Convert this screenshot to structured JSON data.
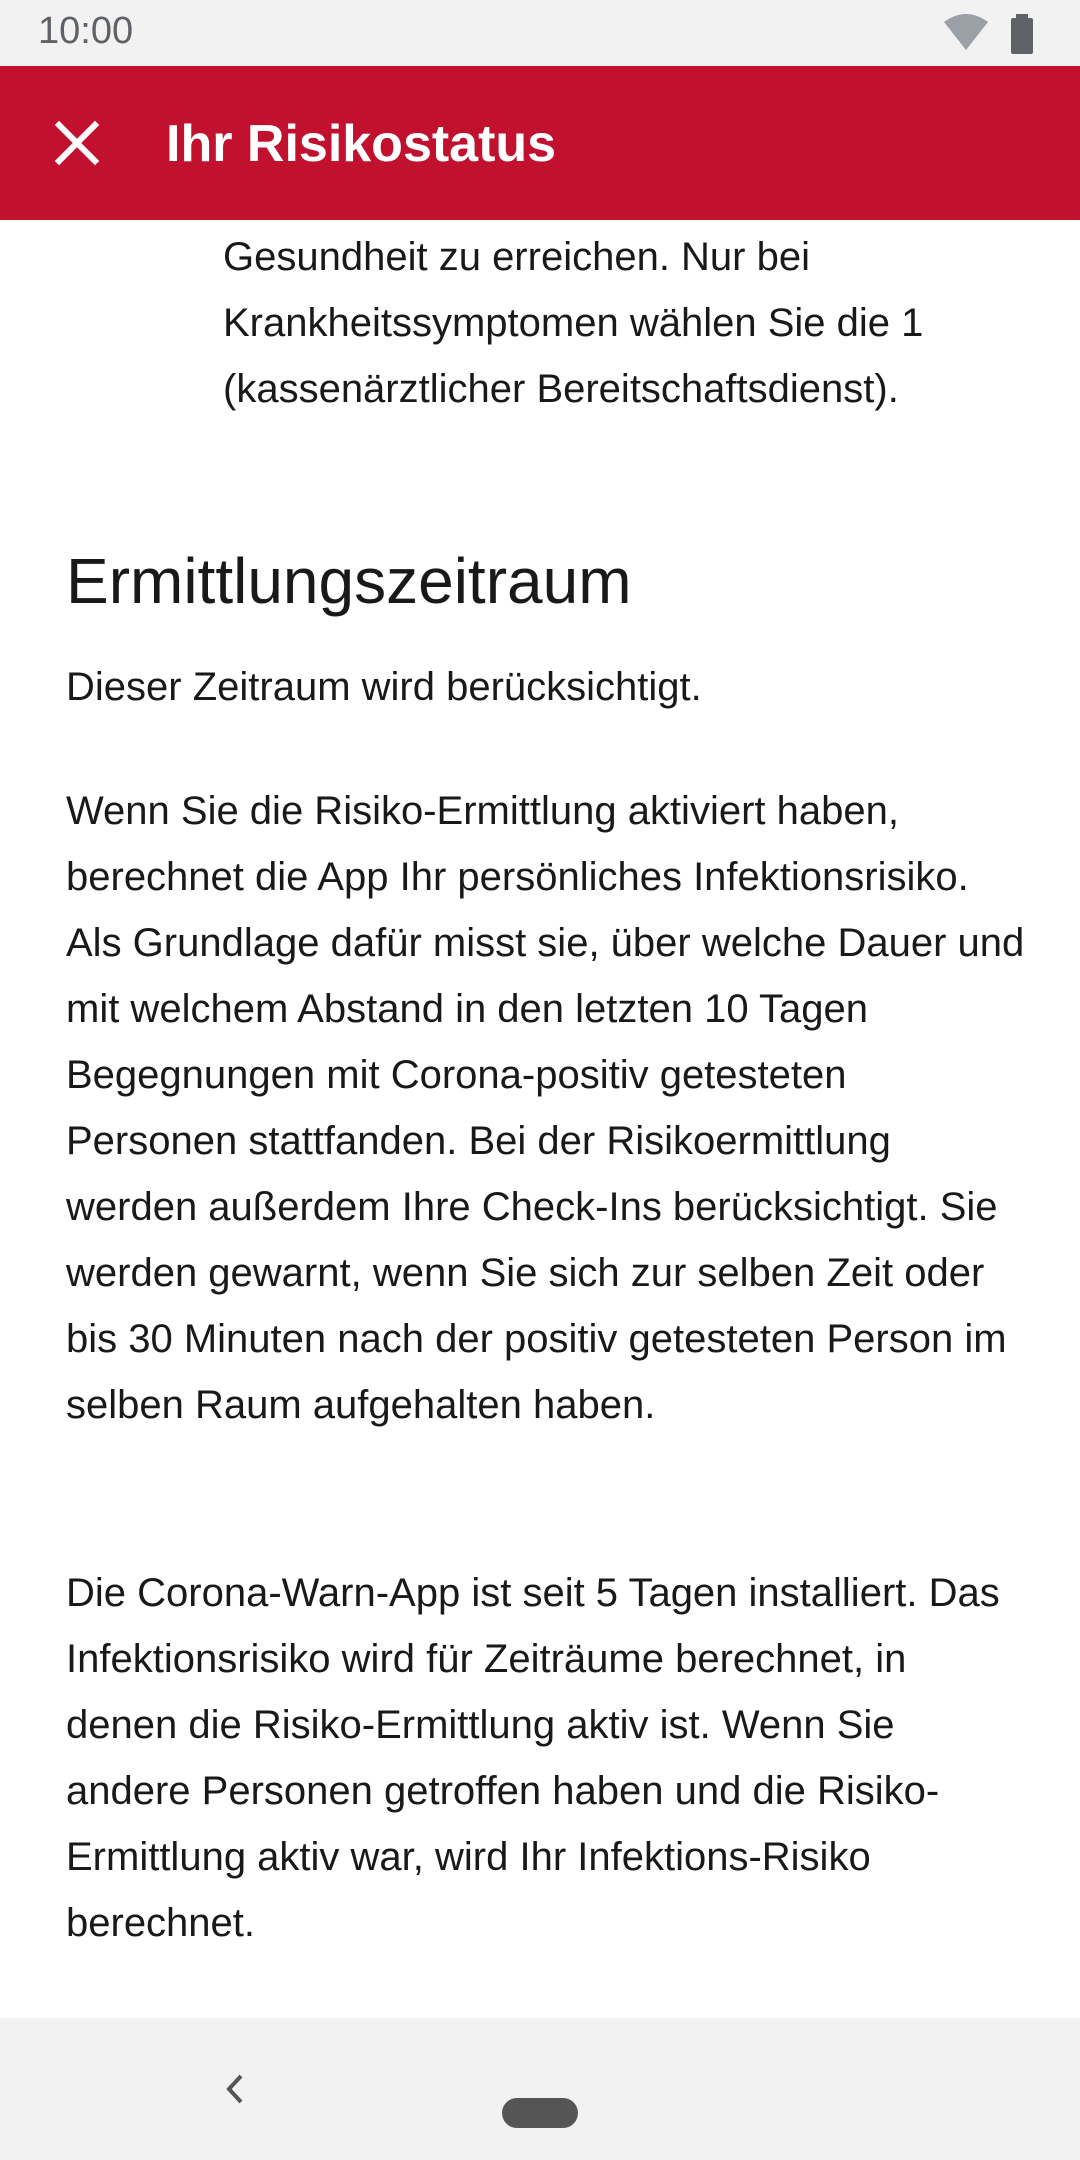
{
  "status_bar": {
    "time": "10:00"
  },
  "app_bar": {
    "title": "Ihr Risikostatus"
  },
  "content": {
    "bullet_continuation": "Gesundheit zu erreichen. Nur bei Krankheitssymptomen wählen Sie die 1 (kassenärztlicher Bereitschaftsdienst).",
    "section_title": "Ermittlungszeitraum",
    "section_subtitle": "Dieser Zeitraum wird berücksichtigt.",
    "paragraph_1": "Wenn Sie die Risiko-Ermittlung aktiviert haben, berechnet die App Ihr persönliches Infektionsrisiko. Als Grundlage dafür misst sie, über welche Dauer und mit welchem Abstand in den letzten 10 Tagen Begegnungen mit Corona-positiv getesteten Personen stattfanden. Bei der Risikoermittlung werden außerdem Ihre Check-Ins berücksichtigt. Sie werden gewarnt, wenn Sie sich zur selben Zeit oder bis 30 Minuten nach der positiv getesteten Person im selben Raum aufgehalten haben.",
    "paragraph_2": "Die Corona-Warn-App ist seit 5 Tagen installiert. Das Infektionsrisiko wird für Zeiträume berechnet, in denen die Risiko-Ermittlung aktiv ist. Wenn Sie andere Personen getroffen haben und die Risiko-Ermittlung aktiv war, wird Ihr Infektions-Risiko berechnet."
  },
  "colors": {
    "app_bar": "#c2112f",
    "system_bars": "#f2f2f2",
    "text": "#17191a"
  },
  "icons": {
    "close": "close-icon",
    "wifi": "wifi-icon",
    "battery": "battery-icon",
    "back": "back-icon",
    "home": "home-handle"
  }
}
